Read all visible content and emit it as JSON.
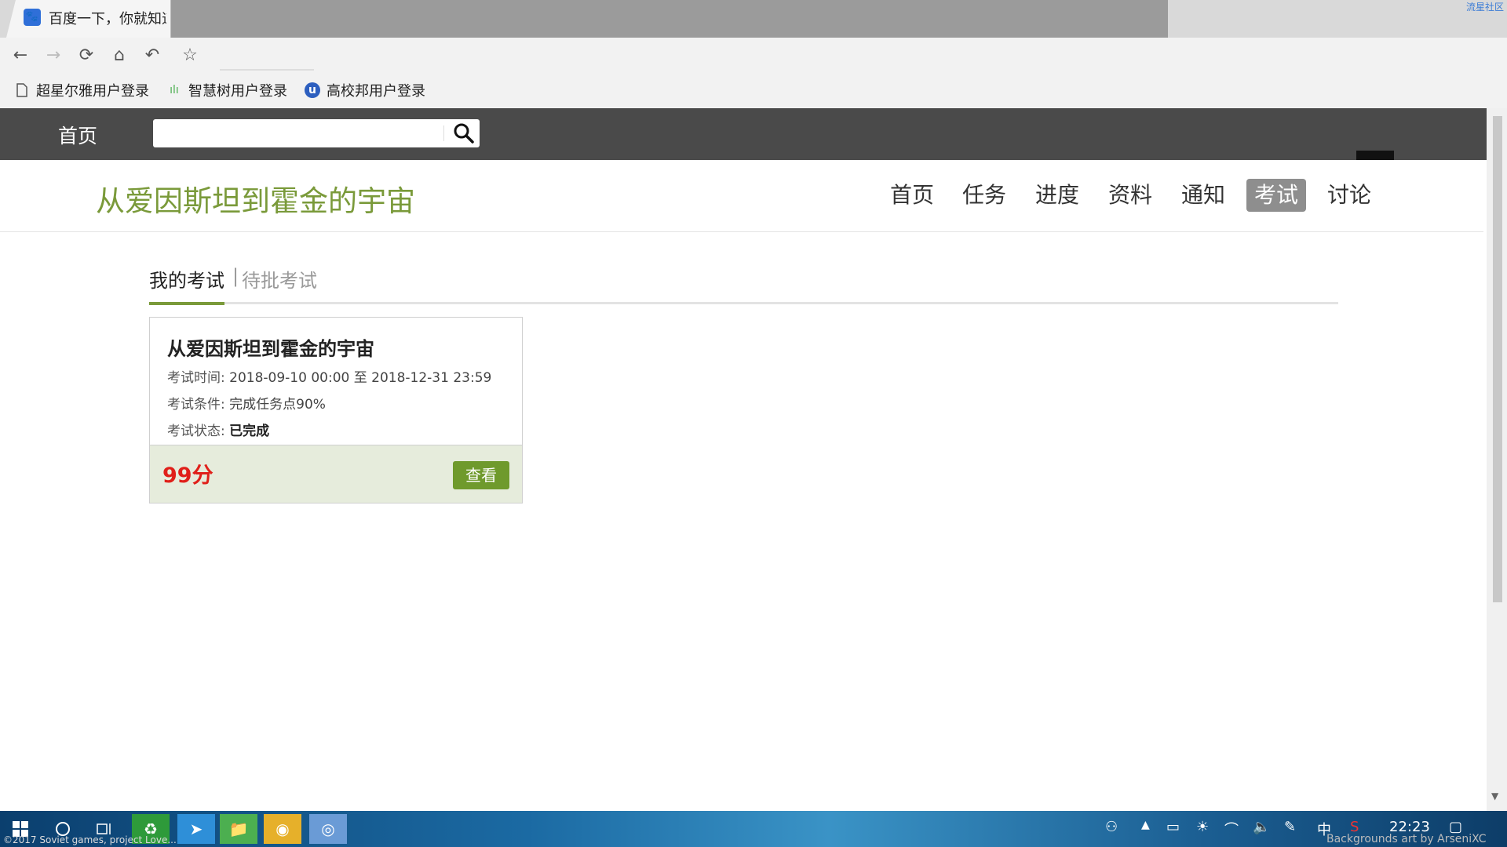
{
  "browser": {
    "tab_title": "百度一下，你就知道",
    "tab_favicon": "paw-icon",
    "corner_link": "流星社区",
    "toolbar": {
      "back": "←",
      "forward": "→",
      "reload": "⟳",
      "home": "⌂",
      "undo": "↶",
      "bookmark": "☆"
    },
    "bookmarks": [
      {
        "label": "超星尔雅用户登录",
        "icon": "file-icon"
      },
      {
        "label": "智慧树用户登录",
        "icon": "zhihuishu-icon"
      },
      {
        "label": "高校邦用户登录",
        "icon": "gaoxiaobang-icon"
      }
    ]
  },
  "site": {
    "header_home": "首页",
    "search_placeholder": "",
    "course_title": "从爱因斯坦到霍金的宇宙",
    "nav": [
      {
        "label": "首页",
        "active": false
      },
      {
        "label": "任务",
        "active": false
      },
      {
        "label": "进度",
        "active": false
      },
      {
        "label": "资料",
        "active": false
      },
      {
        "label": "通知",
        "active": false
      },
      {
        "label": "考试",
        "active": true
      },
      {
        "label": "讨论",
        "active": false
      }
    ],
    "tabs": {
      "my_exams": "我的考试",
      "separator": "|",
      "pending_exams": "待批考试"
    },
    "exam_card": {
      "title": "从爱因斯坦到霍金的宇宙",
      "time_label": "考试时间:",
      "time_value": "2018-09-10 00:00 至 2018-12-31 23:59",
      "condition_label": "考试条件:",
      "condition_value": "完成任务点90%",
      "status_label": "考试状态:",
      "status_value": "已完成",
      "score": "99分",
      "view_button": "查看"
    }
  },
  "taskbar": {
    "time": "22:23",
    "ime": "中",
    "watermark_left": "©2017 Soviet games, project Love...",
    "watermark_right": "Backgrounds art by ArseniXC"
  },
  "colors": {
    "accent_green": "#7a9a3a",
    "button_green": "#6f9a2c",
    "score_red": "#e0201a",
    "header_dark": "#4a4a4a"
  }
}
